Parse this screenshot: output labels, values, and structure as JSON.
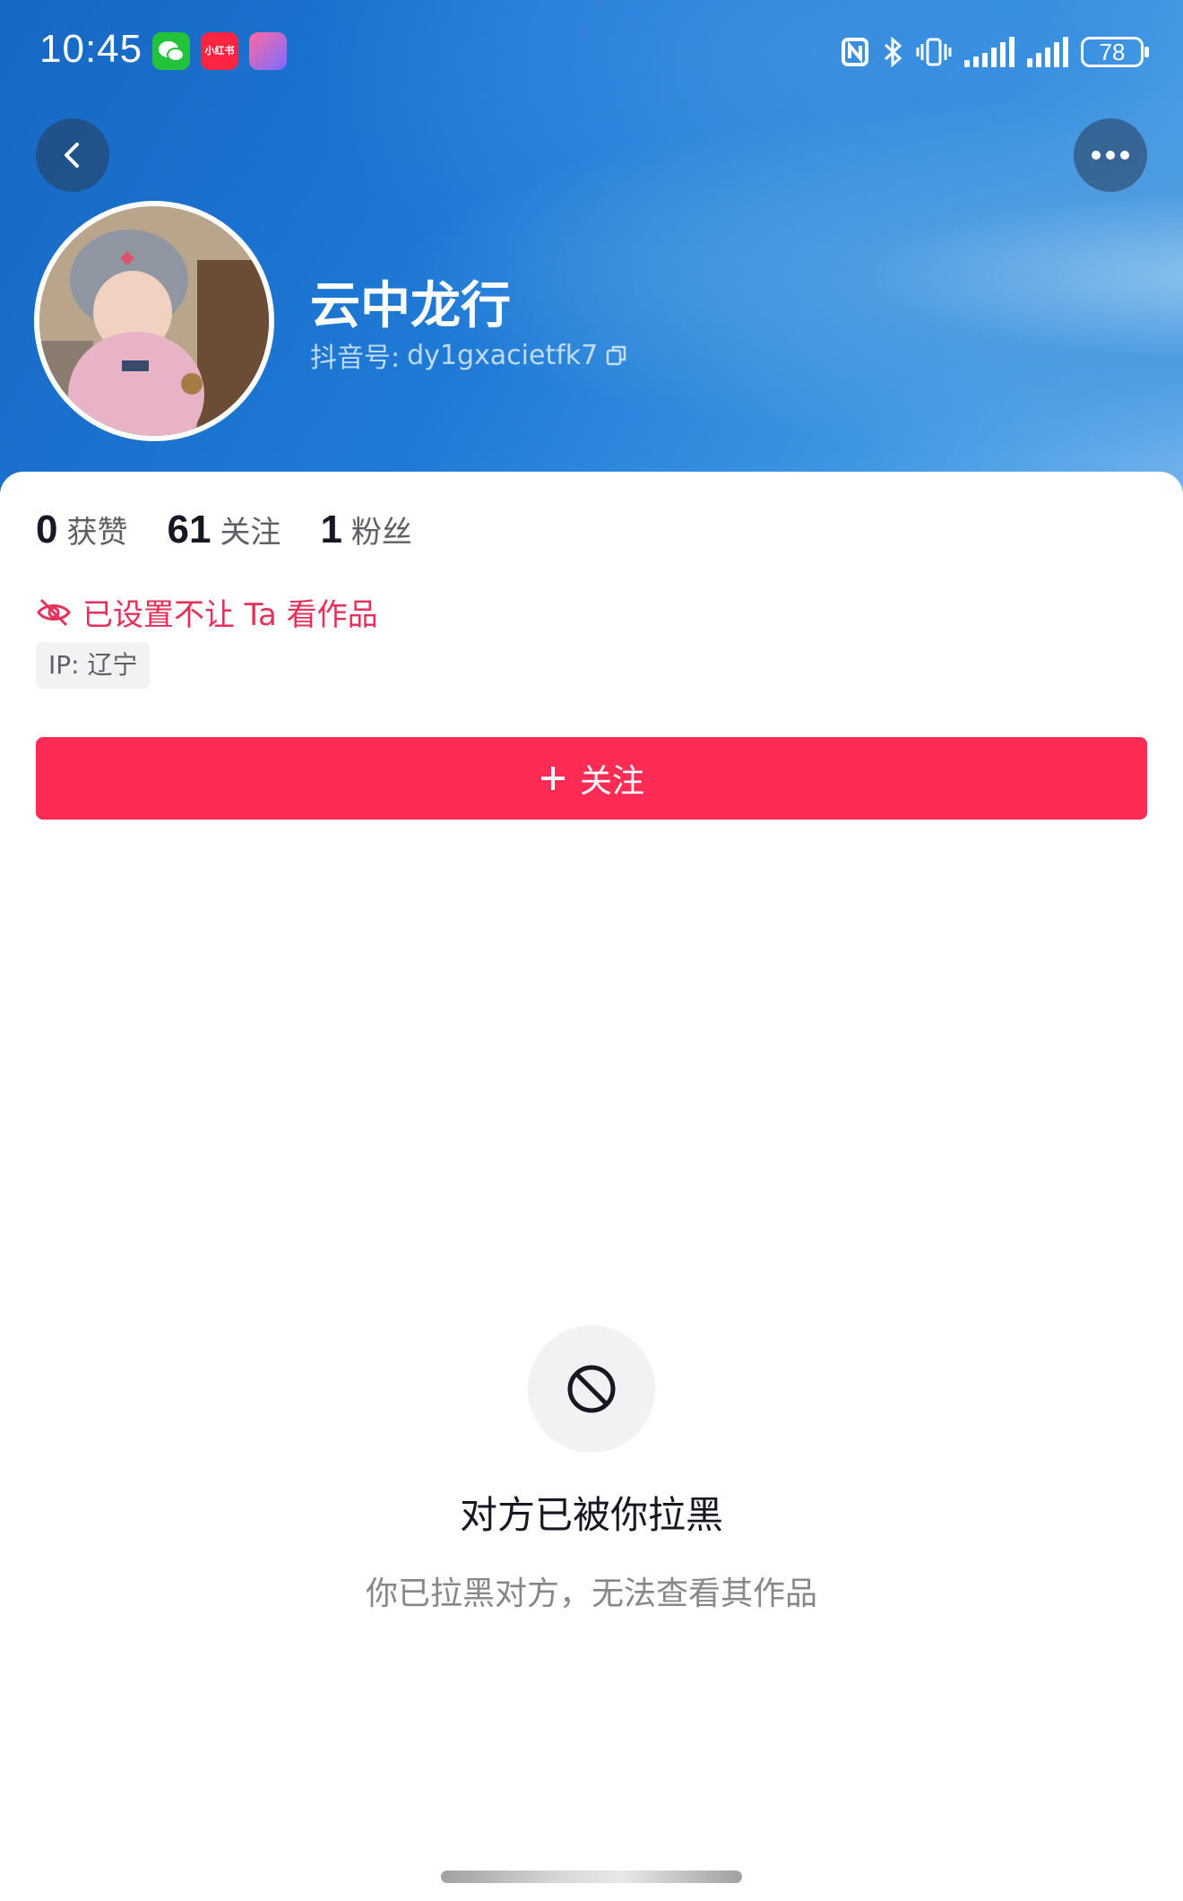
{
  "status_bar": {
    "time": "10:45",
    "notification_icons": [
      "wechat-icon",
      "xiaohongshu-icon",
      "app-icon"
    ],
    "xhs_label": "小红书",
    "battery": "78"
  },
  "header": {
    "back_icon": "chevron-left-icon",
    "more_icon": "more-dots-icon"
  },
  "profile": {
    "username": "云中龙行",
    "douyin_id_label": "抖音号:",
    "douyin_id": "dy1gxacietfk7",
    "stats": [
      {
        "num": "0",
        "label": "获赞"
      },
      {
        "num": "61",
        "label": "关注"
      },
      {
        "num": "1",
        "label": "粉丝"
      }
    ],
    "hidden_notice": "已设置不让 Ta 看作品",
    "ip_label": "IP: 辽宁",
    "follow_label": "关注"
  },
  "blocked": {
    "title": "对方已被你拉黑",
    "description": "你已拉黑对方，无法查看其作品"
  },
  "colors": {
    "accent": "#fe2c55",
    "notice_red": "#e5305a",
    "header_blue": "#1f7ad6"
  }
}
